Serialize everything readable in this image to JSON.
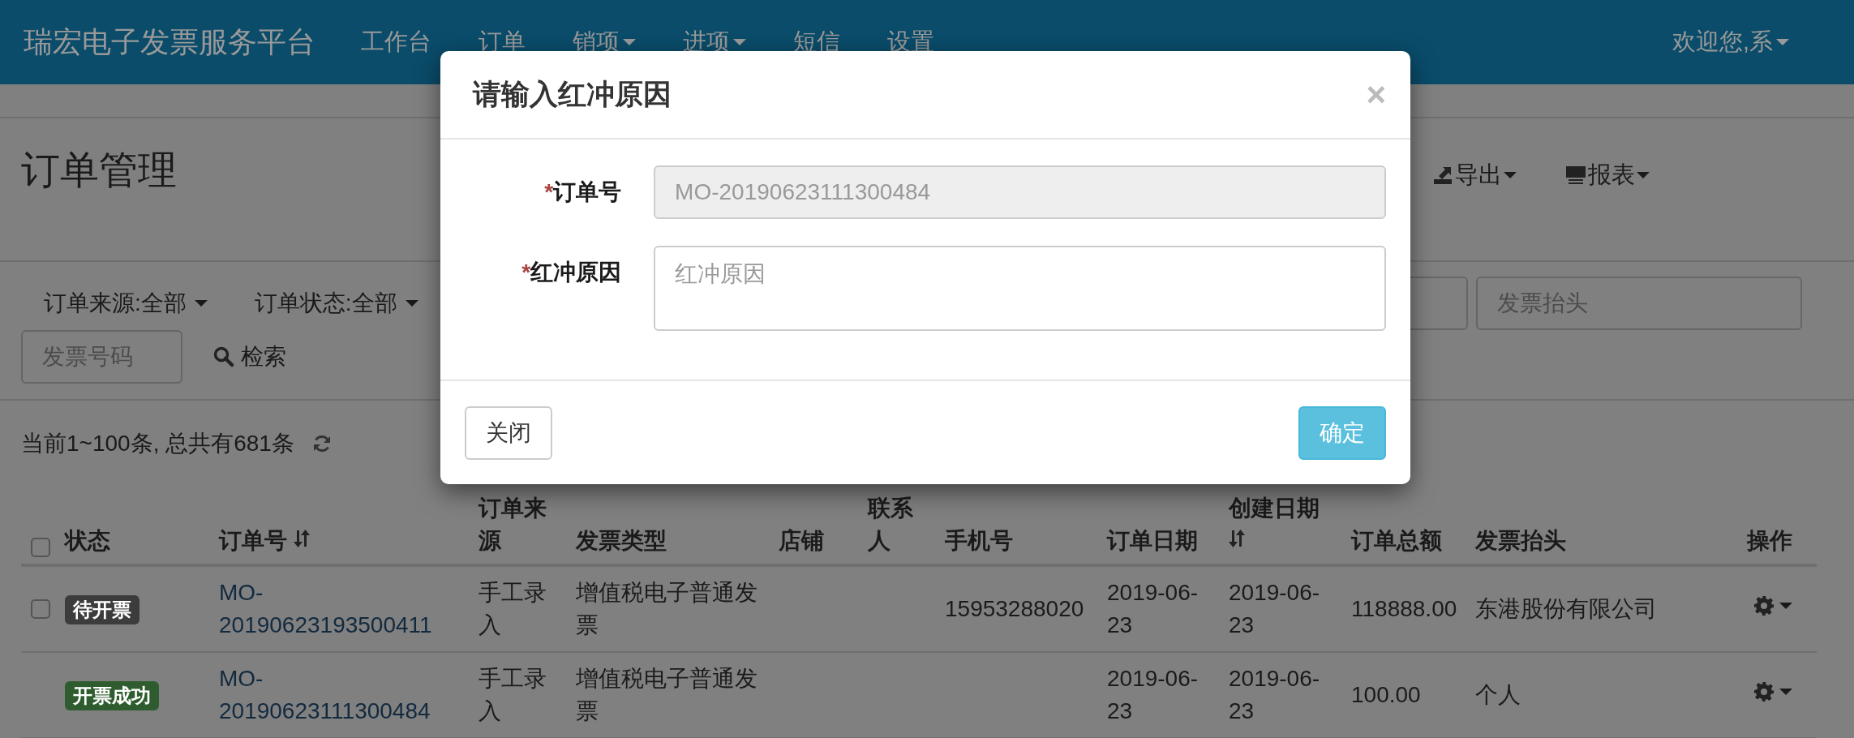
{
  "navbar": {
    "brand": "瑞宏电子发票服务平台",
    "items": [
      {
        "label": "工作台",
        "dropdown": false
      },
      {
        "label": "订单",
        "dropdown": false
      },
      {
        "label": "销项",
        "dropdown": true
      },
      {
        "label": "进项",
        "dropdown": true
      },
      {
        "label": "短信",
        "dropdown": false
      },
      {
        "label": "设置",
        "dropdown": false
      }
    ],
    "user": {
      "label": "欢迎您,系",
      "dropdown": true
    }
  },
  "page": {
    "title": "订单管理",
    "actions": [
      {
        "label": "导出"
      },
      {
        "label": "报表"
      }
    ]
  },
  "filters": {
    "dropdowns": [
      {
        "label": "订单来源:全部"
      },
      {
        "label": "订单状态:全部"
      }
    ],
    "fields": [
      {
        "disabled": false
      },
      {
        "disabled": false,
        "placeholder": "发票抬头"
      }
    ],
    "invoice_field": {
      "placeholder": "发票号码"
    },
    "search_button": "检索"
  },
  "summary": "当前1~100条, 总共有681条",
  "table": {
    "all_checked": false,
    "columns": [
      {
        "label": "状态",
        "sortable": false
      },
      {
        "label": "订单号",
        "sortable": true
      },
      {
        "label": "订单来源",
        "sortable": false
      },
      {
        "label": "发票类型",
        "sortable": false
      },
      {
        "label": "店铺",
        "sortable": false
      },
      {
        "label": "联系人",
        "sortable": false
      },
      {
        "label": "手机号",
        "sortable": false
      },
      {
        "label": "订单日期",
        "sortable": false
      },
      {
        "label": "创建日期",
        "sortable": true
      },
      {
        "label": "订单总额",
        "sortable": false
      },
      {
        "label": "发票抬头",
        "sortable": false
      },
      {
        "label": "操作",
        "sortable": false
      }
    ],
    "rows": [
      {
        "checked": false,
        "status": {
          "label": "待开票",
          "color": "#3c3c3c"
        },
        "order_no": "MO-20190623193500411",
        "source": "手工录入",
        "invoice_type": "增值税电子普通发票",
        "phone": "15953288020",
        "order_date": "2019-06-23",
        "created_date": "2019-06-23",
        "total": "118888.00",
        "invoice_title": "东港股份有限公司"
      },
      {
        "status": {
          "label": "开票成功",
          "color": "#2e5c2e"
        },
        "order_no": "MO-20190623111300484",
        "source": "手工录入",
        "invoice_type": "增值税电子普通发票",
        "order_date": "2019-06-23",
        "created_date": "2019-06-23",
        "total": "100.00",
        "invoice_title": "个人"
      }
    ]
  },
  "dialog": {
    "title": "请输入红冲原因",
    "close_icon": "×",
    "fields": [
      {
        "label": "订单号",
        "required_mark": "*",
        "kind": "input",
        "disabled": true,
        "value": "MO-20190623111300484"
      },
      {
        "label": "红冲原因",
        "required_mark": "*",
        "kind": "textarea",
        "disabled": false,
        "placeholder": "红冲原因"
      }
    ],
    "buttons": [
      {
        "label": "关闭",
        "kind": "default"
      },
      {
        "label": "确定",
        "kind": "info"
      }
    ]
  }
}
